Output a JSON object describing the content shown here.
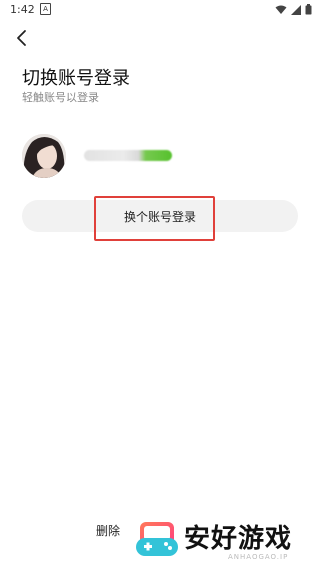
{
  "status_bar": {
    "time": "1:42",
    "notif": "A"
  },
  "header": {
    "title": "切换账号登录",
    "subtitle": "轻触账号以登录"
  },
  "account": {
    "name_redacted": true
  },
  "actions": {
    "switch_label": "换个账号登录",
    "delete_label": "删除"
  },
  "watermark": {
    "brand": "安好游戏",
    "url": "ANHAOGAO.IP"
  },
  "colors": {
    "highlight": "#e0403a",
    "button_bg": "#f2f2f2",
    "accent_green": "#56c12d"
  }
}
